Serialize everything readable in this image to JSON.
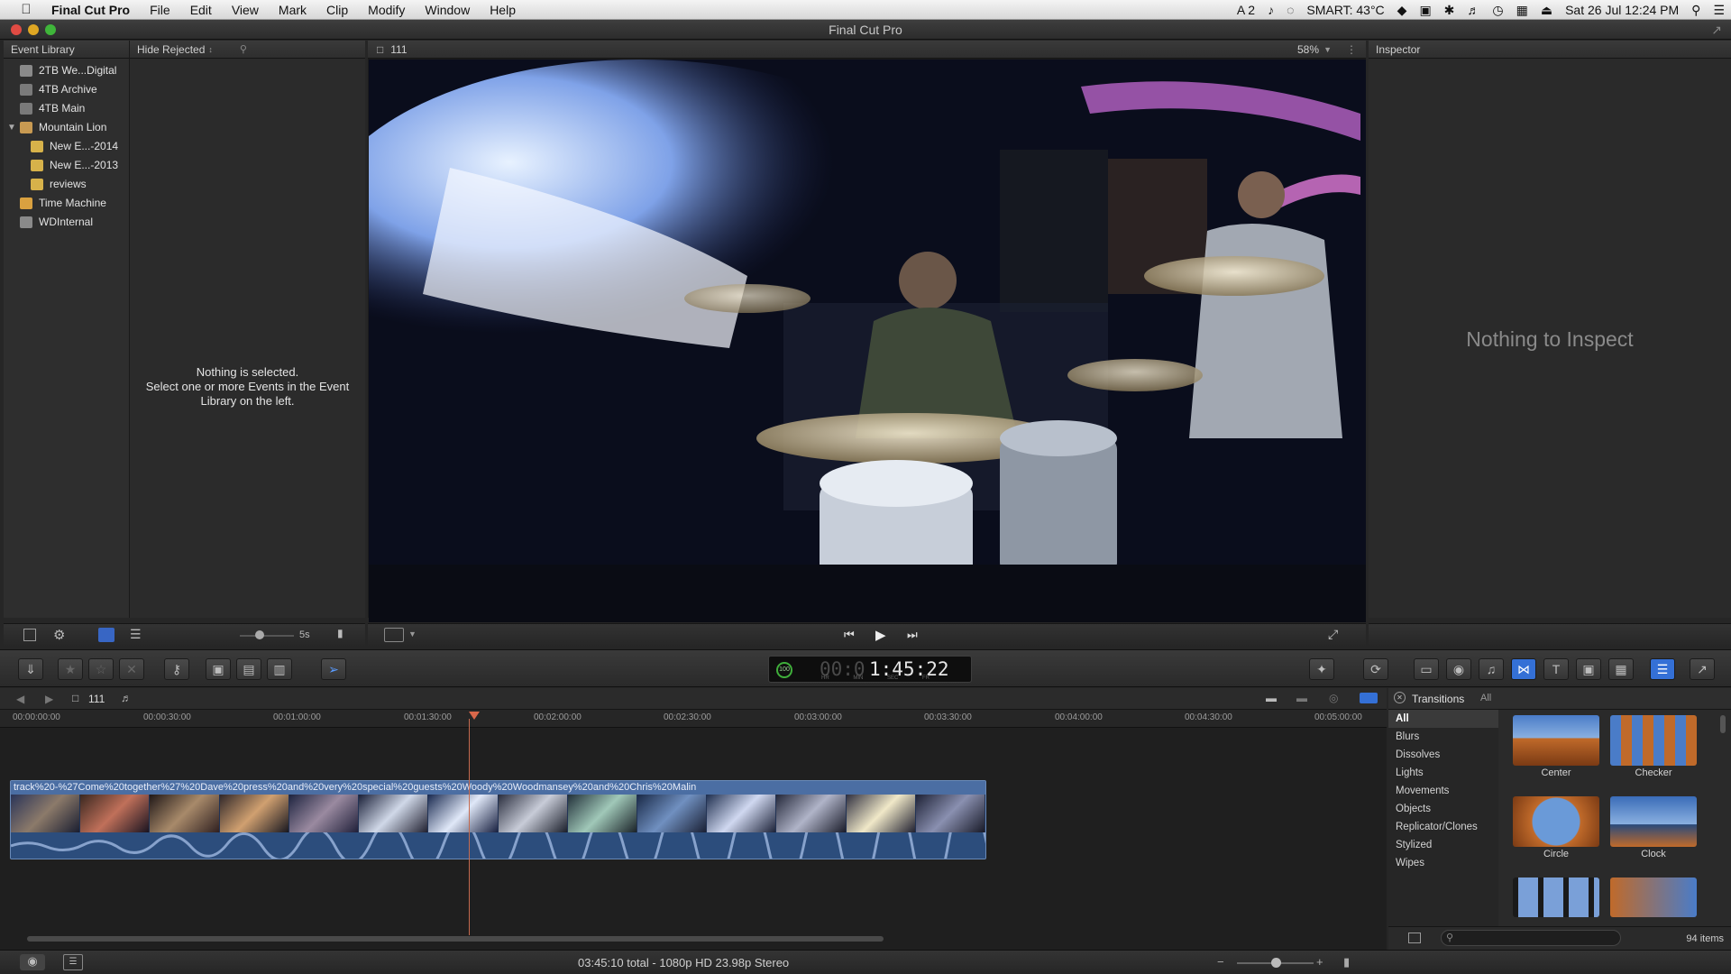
{
  "menubar": {
    "app": "Final Cut Pro",
    "items": [
      "File",
      "Edit",
      "View",
      "Mark",
      "Clip",
      "Modify",
      "Window",
      "Help"
    ],
    "status": {
      "input": "A 2",
      "smart": "SMART: 43°C",
      "datetime": "Sat 26 Jul  12:24 PM"
    }
  },
  "window": {
    "title": "Final Cut Pro"
  },
  "library": {
    "header": "Event Library",
    "items": [
      {
        "label": "2TB We...Digital"
      },
      {
        "label": "4TB Archive"
      },
      {
        "label": "4TB Main"
      },
      {
        "label": "Mountain Lion"
      },
      {
        "label": "New E...-2014"
      },
      {
        "label": "New E...-2013"
      },
      {
        "label": "reviews"
      },
      {
        "label": "Time Machine"
      },
      {
        "label": "WDInternal"
      }
    ],
    "duration_label": "5s"
  },
  "browser": {
    "filter": "Hide Rejected",
    "empty_line1": "Nothing is selected.",
    "empty_line2": "Select one or more Events in the Event",
    "empty_line3": "Library on the left."
  },
  "viewer": {
    "project": "111",
    "zoom": "58%"
  },
  "inspector": {
    "title": "Inspector",
    "empty": "Nothing to Inspect"
  },
  "timecode": {
    "value": "1:45:22",
    "prefix": "00:0",
    "units": [
      "HR",
      "MIN",
      "SEC",
      "FR"
    ],
    "badge": "100"
  },
  "timeline": {
    "project": "111",
    "ticks": [
      "00:00:00:00",
      "00:00:30:00",
      "00:01:00:00",
      "00:01:30:00",
      "00:02:00:00",
      "00:02:30:00",
      "00:03:00:00",
      "00:03:30:00",
      "00:04:00:00",
      "00:04:30:00",
      "00:05:00:00"
    ],
    "clip_title": "track%20-%27Come%20together%27%20Dave%20press%20and%20very%20special%20guests%20Woody%20Woodmansey%20and%20Chris%20Malin"
  },
  "transitions": {
    "title": "Transitions",
    "scope": "All",
    "categories": [
      "All",
      "Blurs",
      "Dissolves",
      "Lights",
      "Movements",
      "Objects",
      "Replicator/Clones",
      "Stylized",
      "Wipes"
    ],
    "items": [
      {
        "label": "Center"
      },
      {
        "label": "Checker"
      },
      {
        "label": "Circle"
      },
      {
        "label": "Clock"
      }
    ],
    "count": "94 items"
  },
  "status": {
    "summary": "03:45:10 total - 1080p HD 23.98p Stereo"
  }
}
